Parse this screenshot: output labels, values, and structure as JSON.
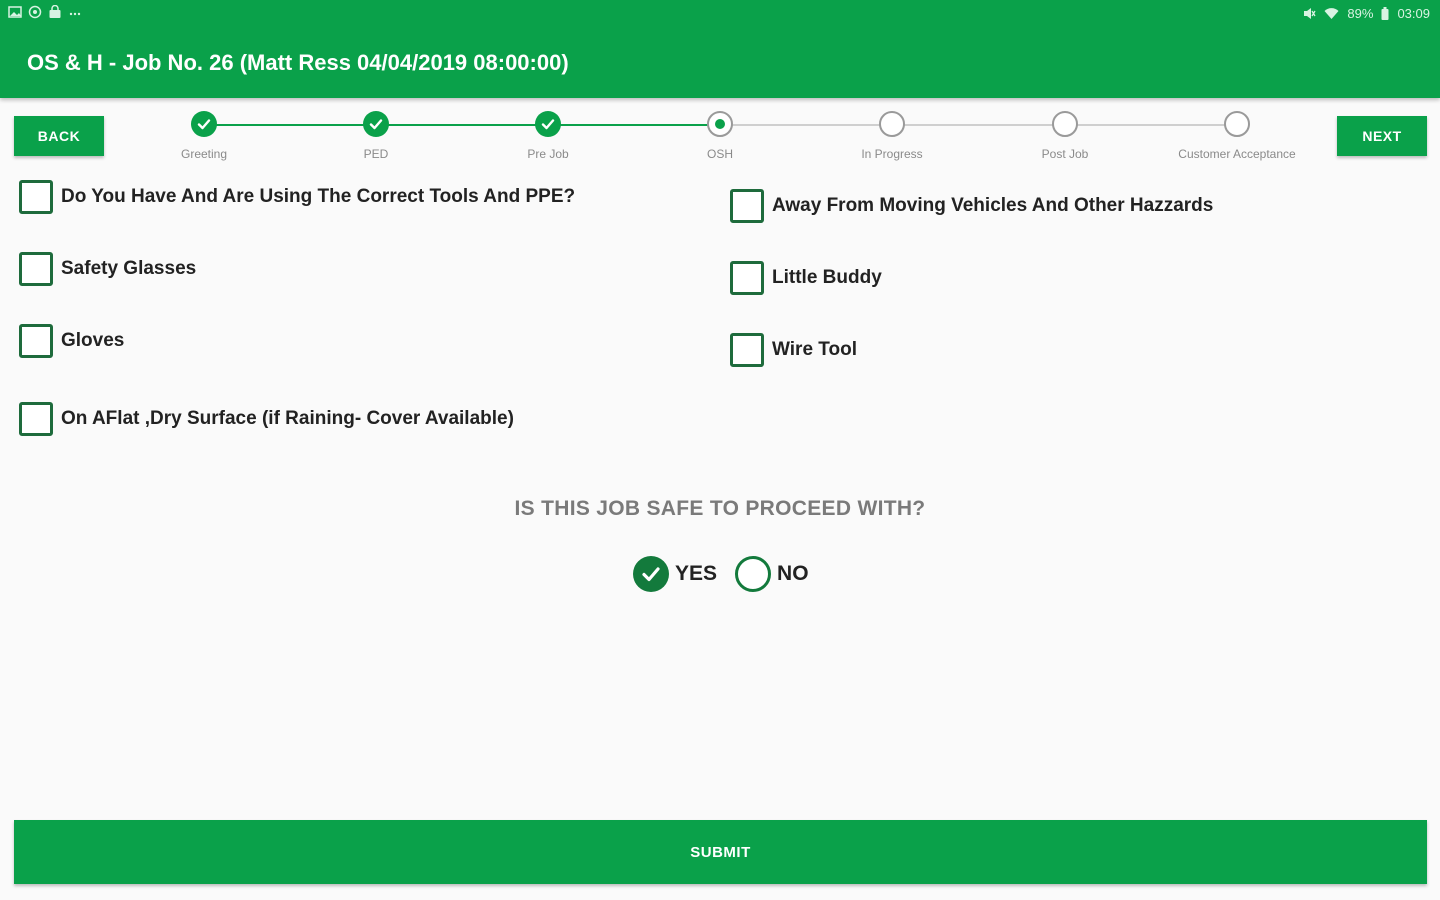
{
  "statusbar": {
    "left_icons": [
      "image-icon",
      "settings-icon",
      "shopping-bag-icon",
      "more-icon"
    ],
    "battery": "89%",
    "time": "03:09"
  },
  "header": {
    "title": "OS & H - Job No. 26 (Matt Ress 04/04/2019 08:00:00)"
  },
  "nav": {
    "back_label": "BACK",
    "next_label": "NEXT"
  },
  "stepper": {
    "steps": [
      {
        "label": "Greeting",
        "state": "done"
      },
      {
        "label": "PED",
        "state": "done"
      },
      {
        "label": "Pre Job",
        "state": "done"
      },
      {
        "label": "OSH",
        "state": "current"
      },
      {
        "label": "In Progress",
        "state": "todo"
      },
      {
        "label": "Post Job",
        "state": "todo"
      },
      {
        "label": "Customer Acceptance",
        "state": "todo"
      }
    ]
  },
  "checklist": {
    "left": [
      {
        "label": "Do You Have And Are Using The Correct Tools And PPE?",
        "checked": false
      },
      {
        "label": "Safety Glasses",
        "checked": false
      },
      {
        "label": "Gloves",
        "checked": false
      },
      {
        "label": "On AFlat ,Dry Surface (if Raining- Cover Available)",
        "checked": false
      }
    ],
    "right": [
      {
        "label": "Away From Moving Vehicles And Other Hazzards",
        "checked": false
      },
      {
        "label": "Little Buddy",
        "checked": false
      },
      {
        "label": "Wire Tool",
        "checked": false
      }
    ]
  },
  "safety": {
    "question": "IS THIS JOB SAFE TO PROCEED WITH?",
    "yes_label": "YES",
    "no_label": "NO",
    "selected": "YES"
  },
  "submit_label": "SUBMIT",
  "colors": {
    "primary": "#0aa14a",
    "checkbox_border": "#1e6b3c",
    "radio": "#137a3c"
  }
}
